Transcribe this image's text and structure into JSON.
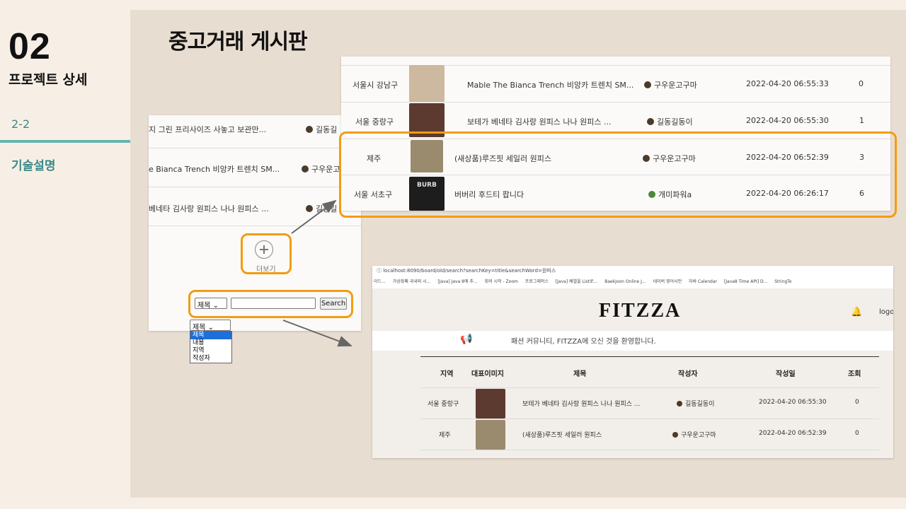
{
  "slide": {
    "number": "02",
    "subtitle": "프로젝트 상세",
    "section_number": "2-2",
    "section_title": "기술설명",
    "board_title": "중고거래 게시판"
  },
  "left_panel": {
    "rows": [
      {
        "title": "지 그린 프리사이즈 사놓고 보관만...",
        "author": "길동길"
      },
      {
        "title": "e Bianca Trench 비앙카 트렌치 SM...",
        "author": "구우운고"
      },
      {
        "title": "베네타 김사랑 원피스 나나 원피스 ...",
        "author": "길동길"
      }
    ],
    "more_label": "더보기",
    "search": {
      "select_value": "제목",
      "button_label": "Search",
      "options": [
        "제목",
        "내용",
        "지역",
        "작성자"
      ]
    }
  },
  "top_table": {
    "rows": [
      {
        "region": "서울시 강남구",
        "title": "Mable The Bianca Trench 비앙카 트렌치 SM...",
        "author": "구우운고구마",
        "date": "2022-04-20 06:55:33",
        "views": "0"
      },
      {
        "region": "서울 중랑구",
        "title": "보테가 베네타 김사랑 원피스 나나 원피스 ...",
        "author": "길동길동이",
        "date": "2022-04-20 06:55:30",
        "views": "1"
      },
      {
        "region": "제주",
        "title": "(새상품)루즈핏 세일러 원피스",
        "author": "구우운고구마",
        "date": "2022-04-20 06:52:39",
        "views": "3"
      },
      {
        "region": "서울 서초구",
        "title": "버버리 후드티 팝니다",
        "author": "개미파워a",
        "date": "2022-04-20 06:26:17",
        "views": "6"
      }
    ]
  },
  "browser": {
    "url": "localhost:8090/board/old/search?searchKey=title&searchWord=원피스",
    "bookmarks": [
      "이드...",
      "가상화폐 국내외 시...",
      "[Java] Java 8에 추...",
      "회의 시작 - Zoom",
      "프로그래머스",
      "[Java] 배열을 List로...",
      "Baekjoon Online J...",
      "네이버 영어사전",
      "자바 Calendar",
      "[Java8 Time API] D...",
      "StringTo"
    ],
    "logo": "FITZZA",
    "logout": "logo",
    "notice": "패션 커뮤니티, FITZZA에 오신 것을 환영합니다.",
    "headers": [
      "지역",
      "대표이미지",
      "제목",
      "작성자",
      "작성일",
      "조회"
    ],
    "rows": [
      {
        "region": "서울 중랑구",
        "title": "보테가 베네타 김사랑 원피스 나나 원피스 ...",
        "author": "길동길동이",
        "date": "2022-04-20 06:55:30",
        "views": "0"
      },
      {
        "region": "제주",
        "title": "(새상품)루즈핏 세일러 원피스",
        "author": "구우운고구마",
        "date": "2022-04-20 06:52:39",
        "views": "0"
      }
    ]
  },
  "colors": {
    "accent": "#f39c12",
    "teal": "#67b3b2",
    "bg": "#f7efe5",
    "panel_bg": "#e8ddd1"
  }
}
